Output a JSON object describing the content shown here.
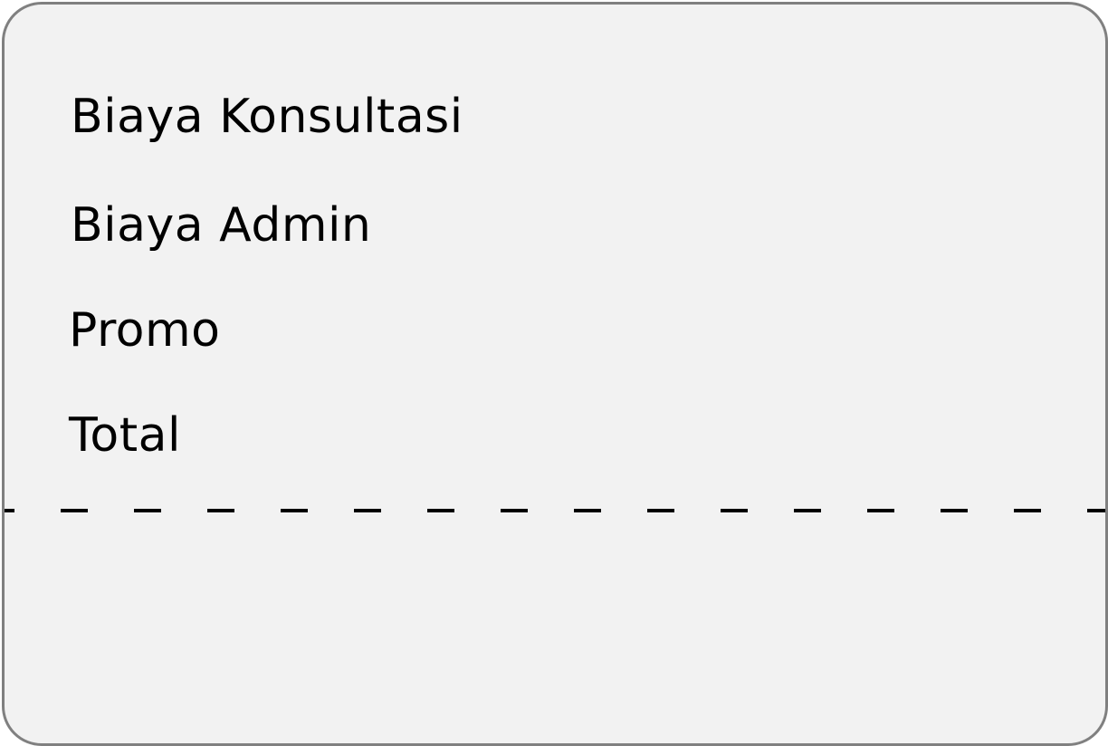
{
  "summary": {
    "rows": [
      {
        "label": "Biaya Konsultasi"
      },
      {
        "label": "Biaya Admin"
      },
      {
        "label": "Promo"
      },
      {
        "label": "Total"
      }
    ]
  },
  "colors": {
    "card_background": "#f2f2f2",
    "card_border": "#808080",
    "text": "#000000",
    "divider": "#000000"
  }
}
